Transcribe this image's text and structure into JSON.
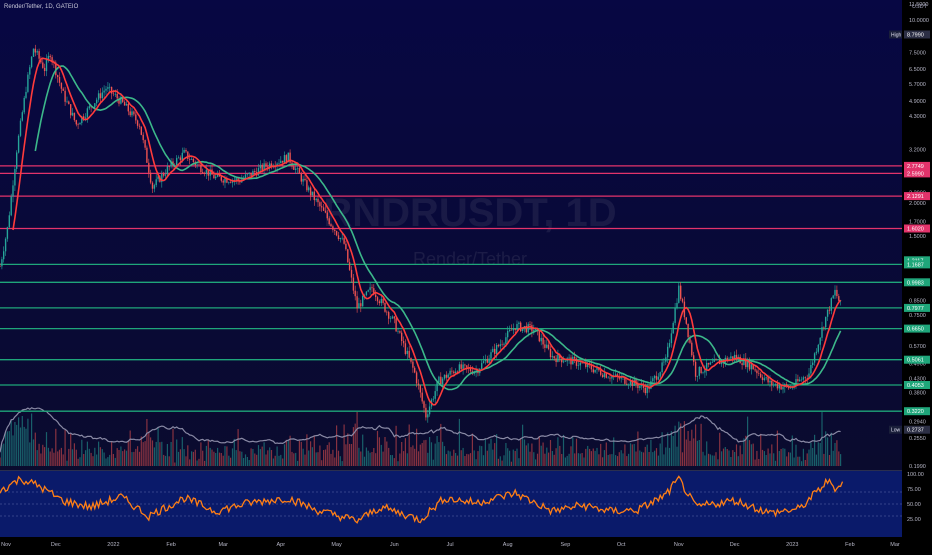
{
  "header": {
    "symbol_title": "Render/Tether, 1D, GATEIO",
    "watermark_symbol": "RNDRUSDT, 1D",
    "watermark_name": "Render/Tether"
  },
  "price_axis": {
    "unit": "USDT",
    "ticks": [
      "11.5000",
      "10.0000",
      "7.5000",
      "6.5000",
      "5.7000",
      "4.9000",
      "4.3000",
      "3.2000",
      "2.7000",
      "2.2000",
      "2.0000",
      "1.7000",
      "1.5000",
      "1.2000",
      "0.8500",
      "0.7500",
      "0.5700",
      "0.4900",
      "0.4300",
      "0.3800",
      "0.2940",
      "0.2550",
      "0.1990"
    ],
    "high_label": "High",
    "high_value": "8.7990",
    "low_label": "Low",
    "low_value": "0.2737",
    "level_labels": [
      "2.7749",
      "2.5990",
      "2.1291",
      "1.6020",
      "1.2117",
      "1.1687",
      "0.9983",
      "0.7977",
      "0.6650",
      "0.5061",
      "0.4053",
      "0.3220"
    ]
  },
  "time_axis": {
    "ticks": [
      "Nov",
      "Dec",
      "2022",
      "Feb",
      "Mar",
      "Apr",
      "May",
      "Jun",
      "Jul",
      "Aug",
      "Sep",
      "Oct",
      "Nov",
      "Dec",
      "2023",
      "Feb",
      "Mar"
    ]
  },
  "rsi_axis": {
    "ticks": [
      "100.00",
      "75.00",
      "50.00",
      "25.00"
    ]
  },
  "colors": {
    "bg_top": "#070743",
    "bg_bottom": "#0a0b2e",
    "rsi_bg": "#0a1a6a",
    "up": "#26a69a",
    "down": "#ef5350",
    "red_level": "#e2336b",
    "green_level": "#1fa67a",
    "ma_fast": "#ff3b3b",
    "ma_slow": "#3cb88a",
    "rsi_line": "#ff7f16",
    "volume_avg": "#8a8aa5"
  },
  "chart_data": {
    "type": "candlestick",
    "symbol": "RNDRUSDT",
    "interval": "1D",
    "exchange": "GATEIO",
    "y_scale": "log",
    "ylim": [
      0.199,
      11.5
    ],
    "x_range": [
      "2021-11-01",
      "2023-03-01"
    ],
    "all_time_high": 8.799,
    "all_time_low": 0.2737,
    "last_price": 1.2117,
    "price_path": [
      {
        "date": "2021-11-01",
        "close": 1.15
      },
      {
        "date": "2021-11-05",
        "close": 1.6
      },
      {
        "date": "2021-11-10",
        "close": 3.2
      },
      {
        "date": "2021-11-15",
        "close": 5.5
      },
      {
        "date": "2021-11-19",
        "close": 7.8
      },
      {
        "date": "2021-11-25",
        "close": 6.5
      },
      {
        "date": "2021-11-28",
        "close": 7.5
      },
      {
        "date": "2021-12-05",
        "close": 5.2
      },
      {
        "date": "2021-12-12",
        "close": 4.0
      },
      {
        "date": "2021-12-20",
        "close": 4.7
      },
      {
        "date": "2021-12-28",
        "close": 5.5
      },
      {
        "date": "2022-01-05",
        "close": 4.9
      },
      {
        "date": "2022-01-15",
        "close": 4.0
      },
      {
        "date": "2022-01-22",
        "close": 2.3
      },
      {
        "date": "2022-01-30",
        "close": 2.7
      },
      {
        "date": "2022-02-08",
        "close": 3.1
      },
      {
        "date": "2022-02-15",
        "close": 2.8
      },
      {
        "date": "2022-02-25",
        "close": 2.5
      },
      {
        "date": "2022-03-10",
        "close": 2.45
      },
      {
        "date": "2022-03-25",
        "close": 2.8
      },
      {
        "date": "2022-04-05",
        "close": 3.0
      },
      {
        "date": "2022-04-15",
        "close": 2.3
      },
      {
        "date": "2022-04-25",
        "close": 1.8
      },
      {
        "date": "2022-05-05",
        "close": 1.4
      },
      {
        "date": "2022-05-12",
        "close": 0.8
      },
      {
        "date": "2022-05-20",
        "close": 0.95
      },
      {
        "date": "2022-06-01",
        "close": 0.7
      },
      {
        "date": "2022-06-12",
        "close": 0.45
      },
      {
        "date": "2022-06-18",
        "close": 0.31
      },
      {
        "date": "2022-06-25",
        "close": 0.42
      },
      {
        "date": "2022-07-05",
        "close": 0.47
      },
      {
        "date": "2022-07-15",
        "close": 0.46
      },
      {
        "date": "2022-07-25",
        "close": 0.55
      },
      {
        "date": "2022-08-05",
        "close": 0.68
      },
      {
        "date": "2022-08-15",
        "close": 0.66
      },
      {
        "date": "2022-08-25",
        "close": 0.52
      },
      {
        "date": "2022-09-05",
        "close": 0.5
      },
      {
        "date": "2022-09-15",
        "close": 0.47
      },
      {
        "date": "2022-09-25",
        "close": 0.44
      },
      {
        "date": "2022-10-05",
        "close": 0.42
      },
      {
        "date": "2022-10-15",
        "close": 0.39
      },
      {
        "date": "2022-10-25",
        "close": 0.5
      },
      {
        "date": "2022-11-01",
        "close": 0.95
      },
      {
        "date": "2022-11-05",
        "close": 0.7
      },
      {
        "date": "2022-11-10",
        "close": 0.45
      },
      {
        "date": "2022-11-20",
        "close": 0.49
      },
      {
        "date": "2022-12-01",
        "close": 0.52
      },
      {
        "date": "2022-12-10",
        "close": 0.48
      },
      {
        "date": "2022-12-20",
        "close": 0.41
      },
      {
        "date": "2022-12-31",
        "close": 0.395
      },
      {
        "date": "2023-01-10",
        "close": 0.45
      },
      {
        "date": "2023-01-18",
        "close": 0.7
      },
      {
        "date": "2023-01-24",
        "close": 0.92
      },
      {
        "date": "2023-01-27",
        "close": 0.82
      }
    ],
    "horizontal_levels": [
      {
        "value": 2.7749,
        "color": "red"
      },
      {
        "value": 2.599,
        "color": "red"
      },
      {
        "value": 2.1291,
        "color": "red"
      },
      {
        "value": 1.602,
        "color": "red"
      },
      {
        "value": 1.1687,
        "color": "green"
      },
      {
        "value": 0.9983,
        "color": "green"
      },
      {
        "value": 0.7977,
        "color": "green"
      },
      {
        "value": 0.665,
        "color": "green"
      },
      {
        "value": 0.5061,
        "color": "green"
      },
      {
        "value": 0.4053,
        "color": "green"
      },
      {
        "value": 0.322,
        "color": "green"
      }
    ],
    "rsi": {
      "ylim": [
        0,
        100
      ],
      "guides": [
        70,
        50,
        30
      ],
      "path": [
        {
          "date": "2021-11-01",
          "value": 72
        },
        {
          "date": "2021-11-12",
          "value": 92
        },
        {
          "date": "2021-11-22",
          "value": 80
        },
        {
          "date": "2021-12-05",
          "value": 55
        },
        {
          "date": "2021-12-20",
          "value": 45
        },
        {
          "date": "2022-01-05",
          "value": 62
        },
        {
          "date": "2022-01-20",
          "value": 30
        },
        {
          "date": "2022-02-08",
          "value": 60
        },
        {
          "date": "2022-02-25",
          "value": 38
        },
        {
          "date": "2022-03-15",
          "value": 52
        },
        {
          "date": "2022-04-05",
          "value": 60
        },
        {
          "date": "2022-04-20",
          "value": 40
        },
        {
          "date": "2022-05-12",
          "value": 22
        },
        {
          "date": "2022-05-25",
          "value": 45
        },
        {
          "date": "2022-06-15",
          "value": 24
        },
        {
          "date": "2022-06-28",
          "value": 60
        },
        {
          "date": "2022-07-15",
          "value": 52
        },
        {
          "date": "2022-08-05",
          "value": 68
        },
        {
          "date": "2022-08-25",
          "value": 38
        },
        {
          "date": "2022-09-10",
          "value": 48
        },
        {
          "date": "2022-09-25",
          "value": 38
        },
        {
          "date": "2022-10-10",
          "value": 40
        },
        {
          "date": "2022-10-25",
          "value": 65
        },
        {
          "date": "2022-11-01",
          "value": 92
        },
        {
          "date": "2022-11-10",
          "value": 45
        },
        {
          "date": "2022-12-01",
          "value": 56
        },
        {
          "date": "2022-12-20",
          "value": 35
        },
        {
          "date": "2023-01-05",
          "value": 42
        },
        {
          "date": "2023-01-20",
          "value": 88
        },
        {
          "date": "2023-01-25",
          "value": 75
        },
        {
          "date": "2023-01-28",
          "value": 90
        }
      ]
    }
  }
}
